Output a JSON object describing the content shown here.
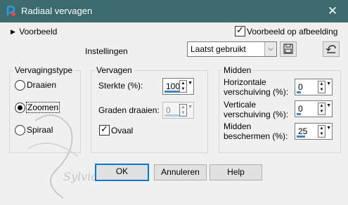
{
  "window": {
    "title": "Radiaal vervagen",
    "close_glyph": "✕"
  },
  "top": {
    "preview_toggle": "Voorbeeld",
    "preview_on_image": {
      "label": "Voorbeeld op afbeelding",
      "checked": true
    },
    "settings_label": "Instellingen",
    "preset_value": "Laatst gebruikt"
  },
  "blur_type": {
    "title": "Vervagingstype",
    "options": [
      {
        "label": "Draaien",
        "selected": false
      },
      {
        "label": "Zoomen",
        "selected": true
      },
      {
        "label": "Spiraal",
        "selected": false
      }
    ]
  },
  "blur": {
    "title": "Vervagen",
    "strength": {
      "label": "Sterkte (%):",
      "value": "100"
    },
    "twist": {
      "label": "Graden draaien:",
      "value": "0",
      "disabled": true
    },
    "oval": {
      "label": "Ovaal",
      "checked": true
    }
  },
  "center": {
    "title": "Midden",
    "h_offset": {
      "label_1": "Horizontale",
      "label_2": "verschuiving (%):",
      "value": "0"
    },
    "v_offset": {
      "label_1": "Verticale",
      "label_2": "verschuiving (%):",
      "value": "0"
    },
    "protect": {
      "label_1": "Midden",
      "label_2": "beschermen (%):",
      "value": "25"
    }
  },
  "buttons": {
    "ok": "OK",
    "cancel": "Annuleren",
    "help": "Help"
  },
  "watermark": {
    "text": "Sylviane"
  },
  "colors": {
    "titlebar": "#3b6a6f",
    "accent": "#0078d7",
    "spin_bar": "#3c87c8"
  }
}
